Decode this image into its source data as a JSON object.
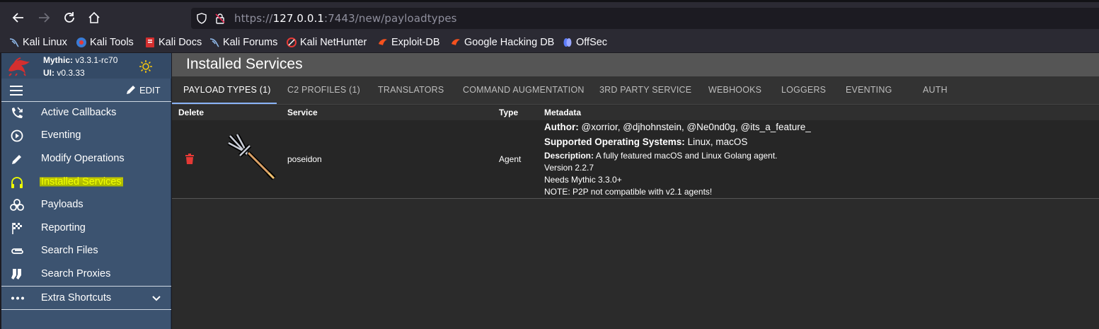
{
  "browser": {
    "url_prefix": "https://",
    "url_host": "127.0.0.1",
    "url_rest": ":7443/new/payloadtypes",
    "bookmarks": [
      {
        "label": "Kali Linux",
        "icon": "kali-dragon-icon"
      },
      {
        "label": "Kali Tools",
        "icon": "kali-tools-icon"
      },
      {
        "label": "Kali Docs",
        "icon": "kali-docs-icon"
      },
      {
        "label": "Kali Forums",
        "icon": "kali-dragon-icon"
      },
      {
        "label": "Kali NetHunter",
        "icon": "nethunter-icon"
      },
      {
        "label": "Exploit-DB",
        "icon": "exploit-db-icon"
      },
      {
        "label": "Google Hacking DB",
        "icon": "ghdb-icon"
      },
      {
        "label": "OffSec",
        "icon": "offsec-icon"
      }
    ]
  },
  "sidebar": {
    "mythic_label": "Mythic:",
    "mythic_version": "v3.3.1-rc70",
    "ui_label": "UI:",
    "ui_version": "v0.3.33",
    "edit_label": "EDIT",
    "items": [
      {
        "label": "Active Callbacks",
        "icon": "phone-callback-icon"
      },
      {
        "label": "Eventing",
        "icon": "play-circle-icon"
      },
      {
        "label": "Modify Operations",
        "icon": "pencil-icon"
      },
      {
        "label": "Installed Services",
        "icon": "headphones-icon"
      },
      {
        "label": "Payloads",
        "icon": "biohazard-icon"
      },
      {
        "label": "Reporting",
        "icon": "checkered-flag-icon"
      },
      {
        "label": "Search Files",
        "icon": "paperclip-icon"
      },
      {
        "label": "Search Proxies",
        "icon": "socks-icon"
      }
    ],
    "extra_label": "Extra Shortcuts"
  },
  "main": {
    "title": "Installed Services",
    "tabs": [
      "PAYLOAD TYPES (1)",
      "C2 PROFILES (1)",
      "TRANSLATORS",
      "COMMAND AUGMENTATION",
      "3RD PARTY SERVICE",
      "WEBHOOKS",
      "LOGGERS",
      "EVENTING",
      "AUTH"
    ],
    "columns": [
      "Delete",
      "Service",
      "Type",
      "Metadata"
    ],
    "rows": [
      {
        "service": "poseidon",
        "type": "Agent",
        "author_label": "Author:",
        "author": "@xorrior, @djhohnstein, @Ne0nd0g, @its_a_feature_",
        "os_label": "Supported Operating Systems:",
        "os": "Linux, macOS",
        "desc_label": "Description:",
        "desc": "A fully featured macOS and Linux Golang agent.",
        "version": "Version 2.2.7",
        "needs": "Needs Mythic 3.3.0+",
        "note": "NOTE: P2P not compatible with v2.1 agents!"
      }
    ]
  },
  "colors": {
    "sidebar_bg": "#3c5370",
    "highlight": "#c3c800",
    "delete_red": "#e53935"
  }
}
